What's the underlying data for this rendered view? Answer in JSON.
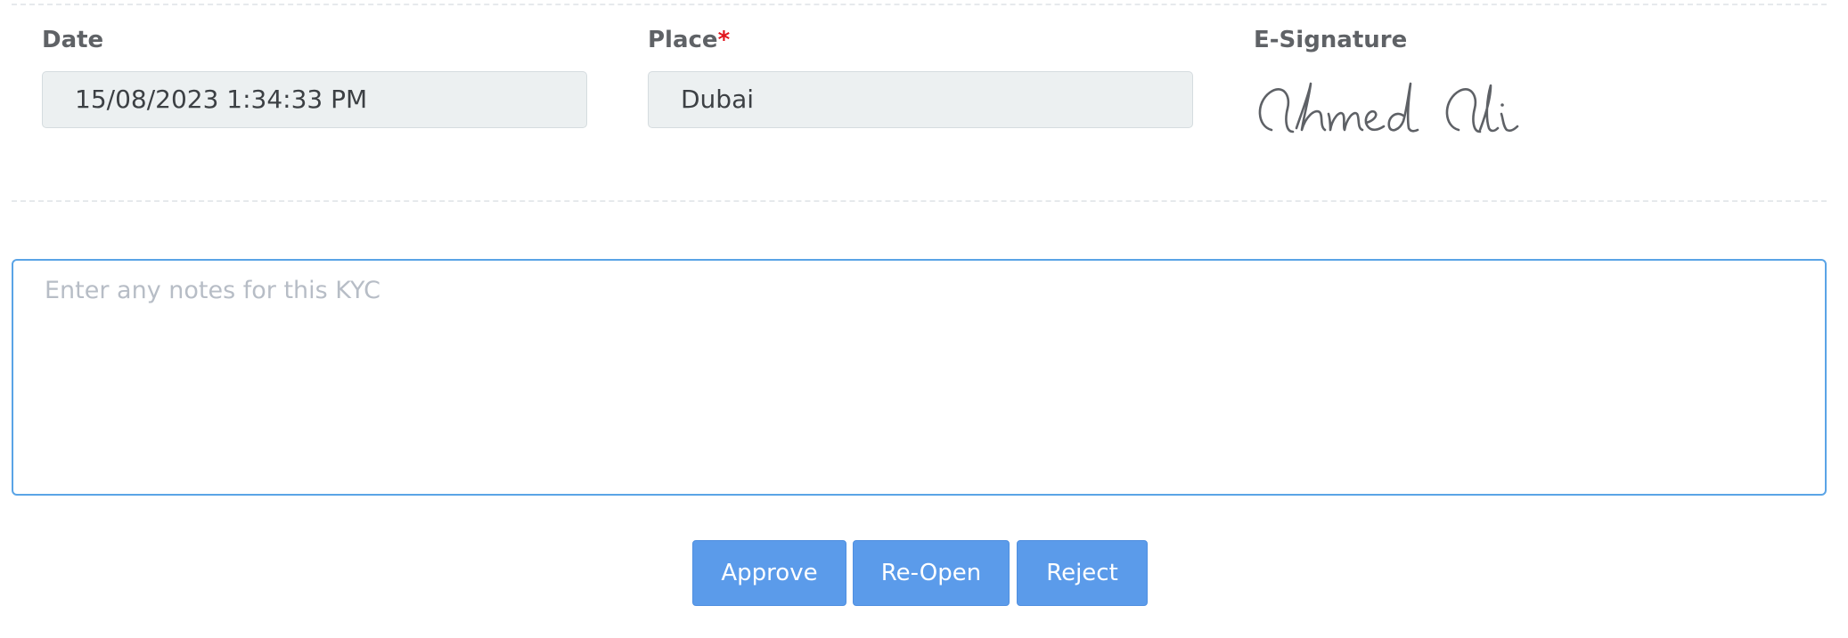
{
  "form": {
    "date": {
      "label": "Date",
      "value": "15/08/2023 1:34:33 PM"
    },
    "place": {
      "label": "Place",
      "required_marker": "*",
      "value": "Dubai"
    },
    "signature": {
      "label": "E-Signature",
      "signed_name": "Ahmed Ali"
    }
  },
  "notes": {
    "placeholder": "Enter any notes for this KYC",
    "value": ""
  },
  "actions": {
    "approve_label": "Approve",
    "reopen_label": "Re-Open",
    "reject_label": "Reject"
  },
  "colors": {
    "button_bg": "#5b9bea",
    "input_bg": "#ecf0f1",
    "focus_border": "#5aa4e6",
    "required": "#e1141c"
  }
}
